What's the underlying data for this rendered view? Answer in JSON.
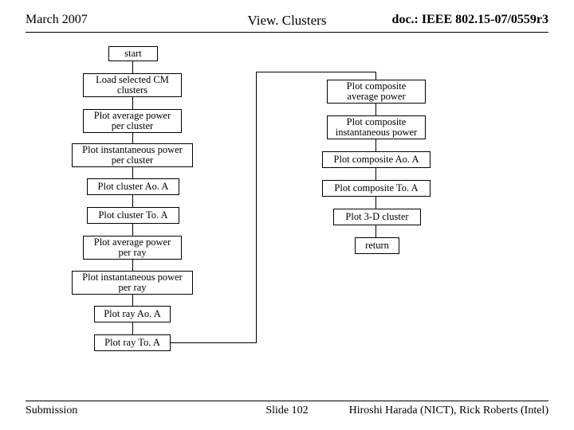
{
  "header": {
    "left": "March 2007",
    "center": "View. Clusters",
    "right": "doc.: IEEE 802.15-07/0559r3"
  },
  "footer": {
    "left": "Submission",
    "center": "Slide 102",
    "right": "Hiroshi Harada (NICT), Rick Roberts (Intel)"
  },
  "flow": {
    "start": "start",
    "left": {
      "load": "Load selected CM clusters",
      "avg_power_cluster": "Plot average power per cluster",
      "inst_power_cluster": "Plot instantaneous power per cluster",
      "cluster_aoa": "Plot cluster Ao. A",
      "cluster_toa": "Plot cluster To. A",
      "avg_power_ray": "Plot average power per ray",
      "inst_power_ray": "Plot instantaneous power per ray",
      "ray_aoa": "Plot ray Ao. A",
      "ray_toa": "Plot ray To. A"
    },
    "right": {
      "comp_avg": "Plot composite average power",
      "comp_inst": "Plot composite instantaneous power",
      "comp_aoa": "Plot composite Ao. A",
      "comp_toa": "Plot composite To. A",
      "plot_3d": "Plot 3-D cluster",
      "return": "return"
    }
  }
}
